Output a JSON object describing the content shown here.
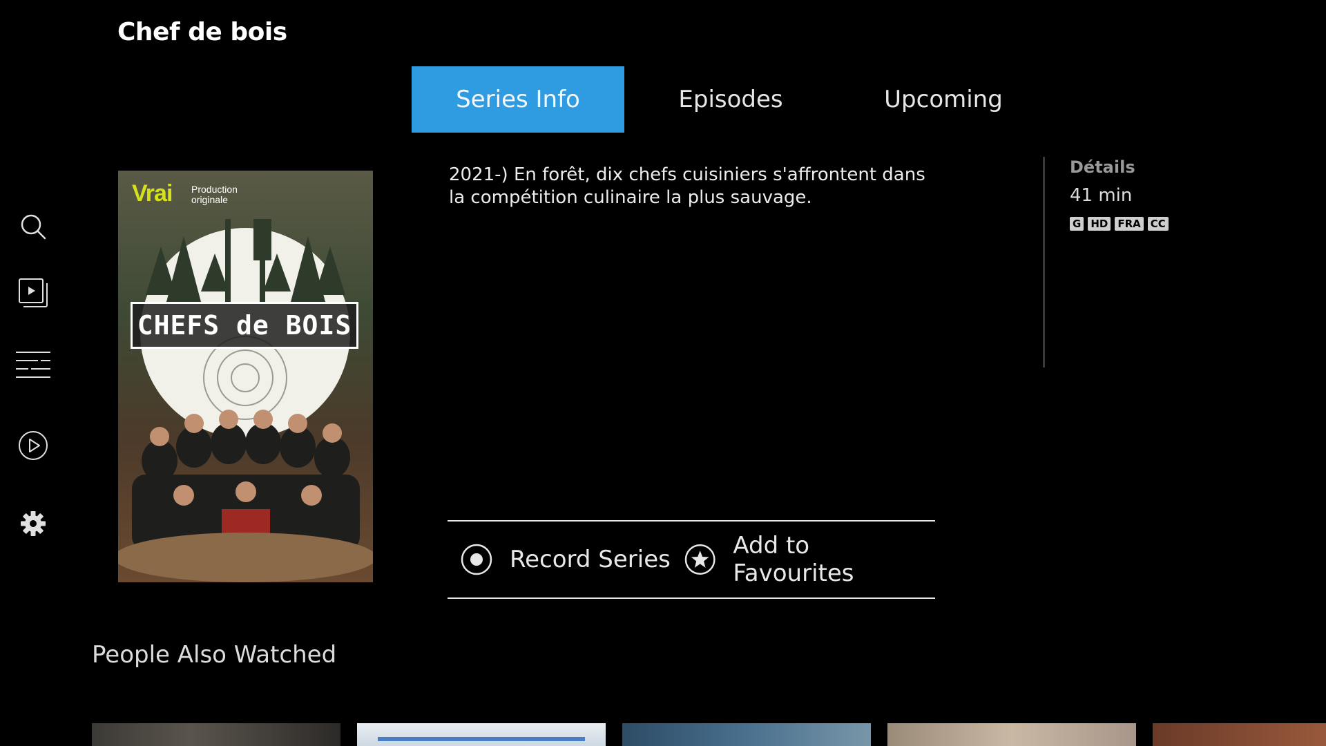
{
  "header": {
    "title": "Chef de bois"
  },
  "sidebar": {
    "items": [
      {
        "name": "search",
        "icon": "search-icon"
      },
      {
        "name": "recordings",
        "icon": "recordings-icon"
      },
      {
        "name": "guide",
        "icon": "guide-icon"
      },
      {
        "name": "on-demand",
        "icon": "play-circle-icon"
      },
      {
        "name": "settings",
        "icon": "gear-icon"
      }
    ]
  },
  "tabs": [
    {
      "label": "Series Info",
      "active": true
    },
    {
      "label": "Episodes",
      "active": false
    },
    {
      "label": "Upcoming",
      "active": false
    }
  ],
  "poster": {
    "brand": "Vrai",
    "brand_sub": "Production originale",
    "title_art": "CHEFS de BOIS"
  },
  "description": "2021-) En forêt, dix chefs cuisiniers s'affrontent dans la compétition culinaire la plus sauvage.",
  "details": {
    "heading": "Détails",
    "duration": "41 min",
    "badges": [
      "G",
      "HD",
      "FRA",
      "CC"
    ]
  },
  "actions": {
    "record_label": "Record Series",
    "favourite_label": "Add to Favourites"
  },
  "recommendations": {
    "title": "People Also Watched"
  },
  "colors": {
    "accent": "#2f9be0",
    "background": "#000000"
  }
}
